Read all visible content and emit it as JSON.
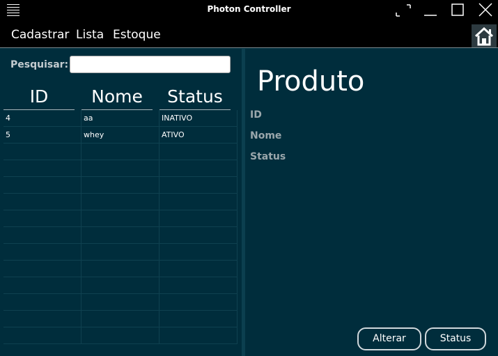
{
  "window": {
    "title": "Photon Controller"
  },
  "menu": {
    "items": [
      "Cadastrar",
      "Lista",
      "Estoque"
    ]
  },
  "search": {
    "label": "Pesquisar:",
    "value": "",
    "placeholder": ""
  },
  "table": {
    "columns": [
      "ID",
      "Nome",
      "Status"
    ],
    "rows": [
      {
        "id": "4",
        "nome": "aa",
        "status": "INATIVO"
      },
      {
        "id": "5",
        "nome": "whey",
        "status": "ATIVO"
      }
    ],
    "empty_rows": 12
  },
  "detail": {
    "title": "Produto",
    "fields": [
      "ID",
      "Nome",
      "Status"
    ]
  },
  "actions": {
    "alterar": "Alterar",
    "status": "Status"
  },
  "colors": {
    "background": "#002d3c",
    "titlebar": "#000000",
    "text": "#ffffff"
  },
  "icons": {
    "menu": "hamburger-icon",
    "fullscreen": "fullscreen-icon",
    "minimize": "minimize-icon",
    "maximize": "maximize-icon",
    "close": "close-icon",
    "home": "home-icon"
  }
}
